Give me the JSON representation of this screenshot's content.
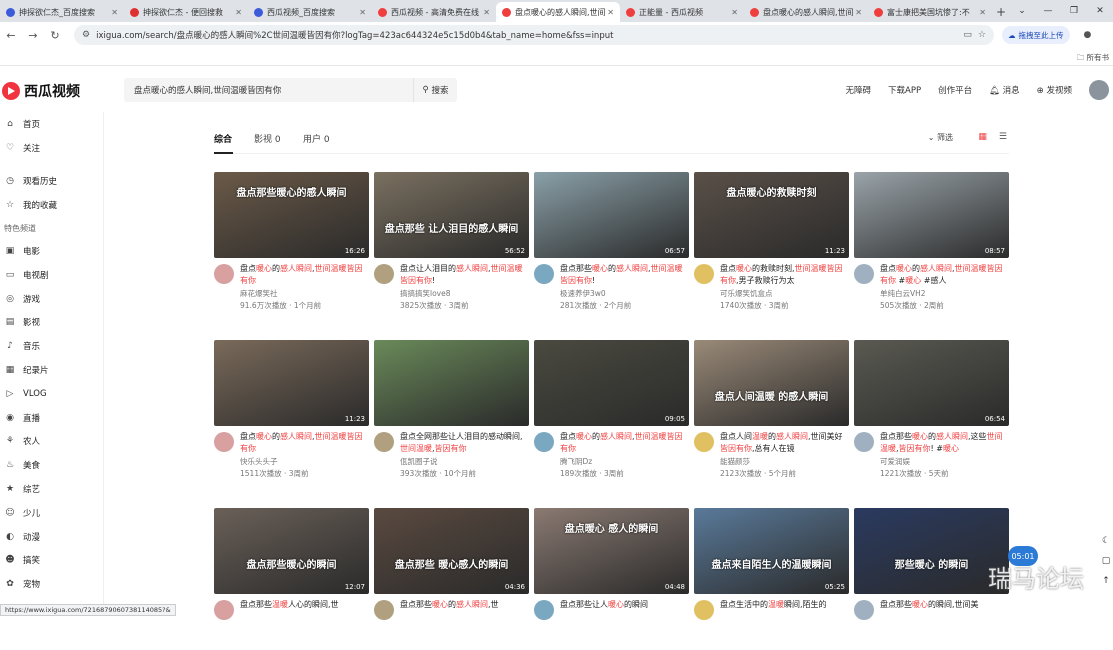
{
  "browser": {
    "tabs": [
      {
        "title": "抻探欲仁杰_百度搜索",
        "color": "#3b5bdb",
        "active": false
      },
      {
        "title": "抻探欲仁杰 - 便回搜救",
        "color": "#e03131",
        "active": false
      },
      {
        "title": "西瓜视频_百度搜索",
        "color": "#3b5bdb",
        "active": false
      },
      {
        "title": "西瓜视频 - 高清免费在线",
        "color": "#f03e3e",
        "active": false
      },
      {
        "title": "盘点暖心的感人瞬间,世间",
        "color": "#f03e3e",
        "active": true
      },
      {
        "title": "正能量 - 西瓜视频",
        "color": "#f03e3e",
        "active": false
      },
      {
        "title": "盘点暖心的感人瞬间,世间",
        "color": "#f03e3e",
        "active": false
      },
      {
        "title": "富士康把美国坑惨了:不",
        "color": "#f03e3e",
        "active": false
      }
    ],
    "new_tab": "+",
    "url": "ixigua.com/search/盘点暖心的感人瞬间%2C世间温暖皆因有你?logTag=423ac644324e5c15d0b4&tab_name=home&fss=input",
    "ext_label": "拖拽至此上传",
    "bookmarks_label": "所有书",
    "status_url": "https://www.ixigua.com/7216879060738114085?&"
  },
  "site": {
    "logo": "西瓜视频",
    "search_query": "盘点暖心的感人瞬间,世间温暖皆因有你",
    "search_btn": "搜索",
    "header_links": [
      "无障碍",
      "下载APP",
      "创作平台",
      "消息",
      "发视频"
    ]
  },
  "sidebar": {
    "top": [
      "首页",
      "关注"
    ],
    "mid": [
      "观看历史",
      "我的收藏"
    ],
    "section": "特色频道",
    "channels": [
      "电影",
      "电视剧",
      "游戏",
      "影视",
      "音乐",
      "纪录片",
      "VLOG",
      "直播",
      "农人",
      "美食",
      "综艺",
      "少儿",
      "动漫",
      "搞笑",
      "宠物"
    ]
  },
  "content_tabs": [
    "综合",
    "影视 0",
    "用户 0"
  ],
  "filter_label": "筛选",
  "cards": [
    {
      "title": "盘点暖心的感人瞬间,世间温暖皆因有你",
      "author": "麻花爆笑社",
      "stats": "91.6万次播放 · 1个月前",
      "dur": "16:26",
      "overlay": "盘点那些暖心的感人瞬间",
      "bg": "#6b5a48"
    },
    {
      "title": "盘点让人泪目的感人瞬间,世间温暖皆因有你!",
      "author": "搞搞搞笑love8",
      "stats": "3825次播放 · 3周前",
      "dur": "56:52",
      "overlay": "盘点那些 让人泪目的感人瞬间",
      "bg": "#7a7060"
    },
    {
      "title": "盘点那些暖心的感人瞬间,世间温暖皆因有你!",
      "author": "极速养伊3w0",
      "stats": "281次播放 · 2个月前",
      "dur": "06:57",
      "overlay": "",
      "bg": "#8aa0a8"
    },
    {
      "title": "盘点暖心的救赎时刻,世间温暖皆因有你,男子救赎行为太",
      "author": "可乐爆笑饥盒点",
      "stats": "1740次播放 · 3周前",
      "dur": "11:23",
      "overlay": "盘点暖心的救赎时刻",
      "bg": "#5a5048"
    },
    {
      "title": "盘点暖心的感人瞬间,世间温暖皆因有你 #暖心 #感人",
      "author": "单纯白云VH2",
      "stats": "505次播放 · 2周前",
      "dur": "08:57",
      "overlay": "",
      "bg": "#9aa4aa"
    },
    {
      "title": "盘点暖心的感人瞬间,世间温暖皆因有你",
      "author": "快乐头头子",
      "stats": "1511次播放 · 3周前",
      "dur": "11:23",
      "overlay": "",
      "bg": "#7a6a5a"
    },
    {
      "title": "盘点全网那些让人泪目的感动瞬间,世间温暖,皆因有你",
      "author": "佤凯圈子说",
      "stats": "393次播放 · 10个月前",
      "dur": "",
      "overlay": "",
      "bg": "#6a8a5a"
    },
    {
      "title": "盘点暖心的感人瞬间,世间温暖皆因有你",
      "author": "腾飞阴Dz",
      "stats": "189次播放 · 3周前",
      "dur": "09:05",
      "overlay": "",
      "bg": "#4a4a40"
    },
    {
      "title": "盘点人间温暖的感人瞬间,世间美好皆因有你,总有人在镜",
      "author": "能猫颜莎",
      "stats": "2123次播放 · 5个月前",
      "dur": "",
      "overlay": "盘点人间温暖 的感人瞬间",
      "bg": "#9a8a78"
    },
    {
      "title": "盘点那些暖心的感人瞬间,这些世间温暖,皆因有你! #暖心",
      "author": "可爱润娱",
      "stats": "1221次播放 · 5天前",
      "dur": "06:54",
      "overlay": "",
      "bg": "#5a5a52"
    },
    {
      "title": "盘点那些温暖人心的瞬间,世",
      "author": "",
      "stats": "",
      "dur": "12:07",
      "overlay": "盘点那些暖心的瞬间",
      "bg": "#6a6058"
    },
    {
      "title": "盘点那些暖心的感人瞬间,世",
      "author": "",
      "stats": "",
      "dur": "04:36",
      "overlay": "盘点那些 暖心感人的瞬间",
      "bg": "#5a4a40"
    },
    {
      "title": "盘点那些让人暖心的瞬间",
      "author": "",
      "stats": "",
      "dur": "04:48",
      "overlay": "盘点暖心 感人的瞬间",
      "bg": "#8a7a72"
    },
    {
      "title": "盘点生活中的温暖瞬间,陌生的",
      "author": "",
      "stats": "",
      "dur": "05:25",
      "overlay": "盘点来自陌生人的温暖瞬间",
      "bg": "#5a7a9a"
    },
    {
      "title": "盘点那些暖心的瞬间,世间美",
      "author": "",
      "stats": "",
      "dur": "",
      "overlay": "那些暖心 的瞬间",
      "bg": "#2a3a60"
    }
  ],
  "timer": "05:01",
  "watermark": "瑞马论坛"
}
